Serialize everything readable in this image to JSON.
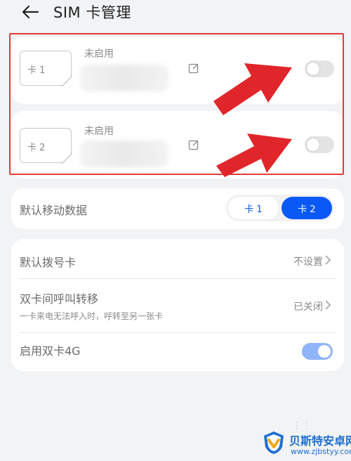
{
  "header": {
    "title": "SIM 卡管理",
    "back_icon": "arrow-left-icon"
  },
  "sim_cards": [
    {
      "chip_label": "卡 1",
      "status": "未启用",
      "enabled": false
    },
    {
      "chip_label": "卡 2",
      "status": "未启用",
      "enabled": false
    }
  ],
  "default_data": {
    "label": "默认移动数据",
    "options": [
      "卡 1",
      "卡 2"
    ],
    "selected": "卡 2"
  },
  "settings": {
    "default_dial": {
      "title": "默认拨号卡",
      "value": "不设置"
    },
    "call_forward": {
      "title": "双卡间呼叫转移",
      "subtitle": "一卡来电无法呼入时，呼转至另一张卡",
      "value": "已关闭"
    },
    "dual_4g": {
      "title": "启用双卡4G",
      "enabled": true
    }
  },
  "watermark": {
    "title": "贝斯特安卓网",
    "url": "www.zjbstyy.com"
  },
  "colors": {
    "accent": "#0a59f7",
    "annotation_red": "#e23a3a",
    "toggle_on": "#8fb4f8"
  }
}
